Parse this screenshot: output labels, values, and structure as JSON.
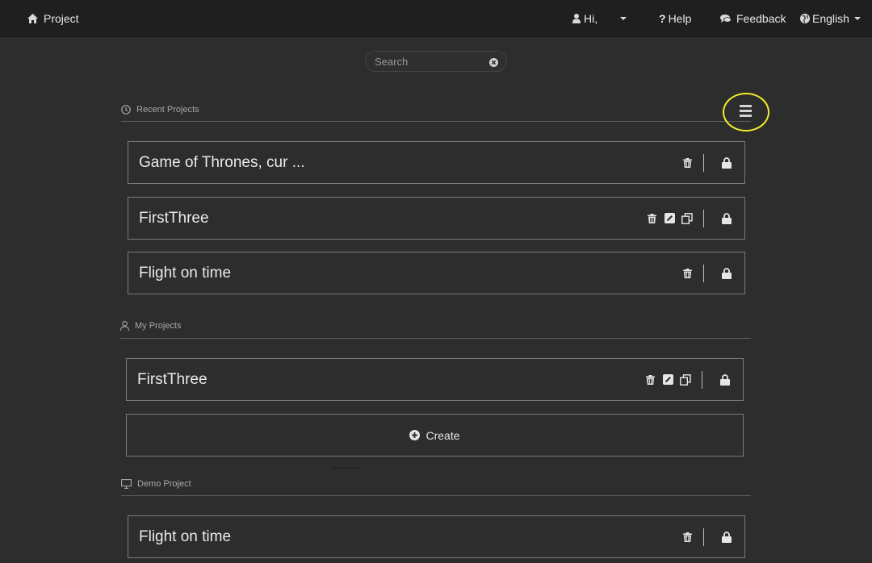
{
  "nav": {
    "project": "Project",
    "user_greeting": "Hi,",
    "help": "Help",
    "feedback": "Feedback",
    "language": "English"
  },
  "search": {
    "placeholder": "Search"
  },
  "sections": {
    "recent": {
      "title": "Recent Projects",
      "cards": [
        {
          "title": "Game of Thrones, cur ..."
        },
        {
          "title": "FirstThree"
        },
        {
          "title": "Flight on time"
        }
      ]
    },
    "my": {
      "title": "My Projects",
      "cards": [
        {
          "title": "FirstThree"
        }
      ],
      "create_label": "Create"
    },
    "demo": {
      "title": "Demo Project",
      "cards": [
        {
          "title": "Flight on time"
        }
      ]
    }
  },
  "colors": {
    "background": "#2d2d2d",
    "topbar": "#1f1f1f",
    "highlight_ring": "#f2ee2a",
    "card_border": "#7a7a7a"
  },
  "icons": [
    "home-icon",
    "user-icon",
    "question-icon",
    "chat-icon",
    "globe-icon",
    "clear-icon",
    "clock-icon",
    "person-icon",
    "monitor-icon",
    "menu-icon",
    "trash-icon",
    "edit-icon",
    "copy-icon",
    "lock-icon",
    "plus-circle-icon"
  ]
}
